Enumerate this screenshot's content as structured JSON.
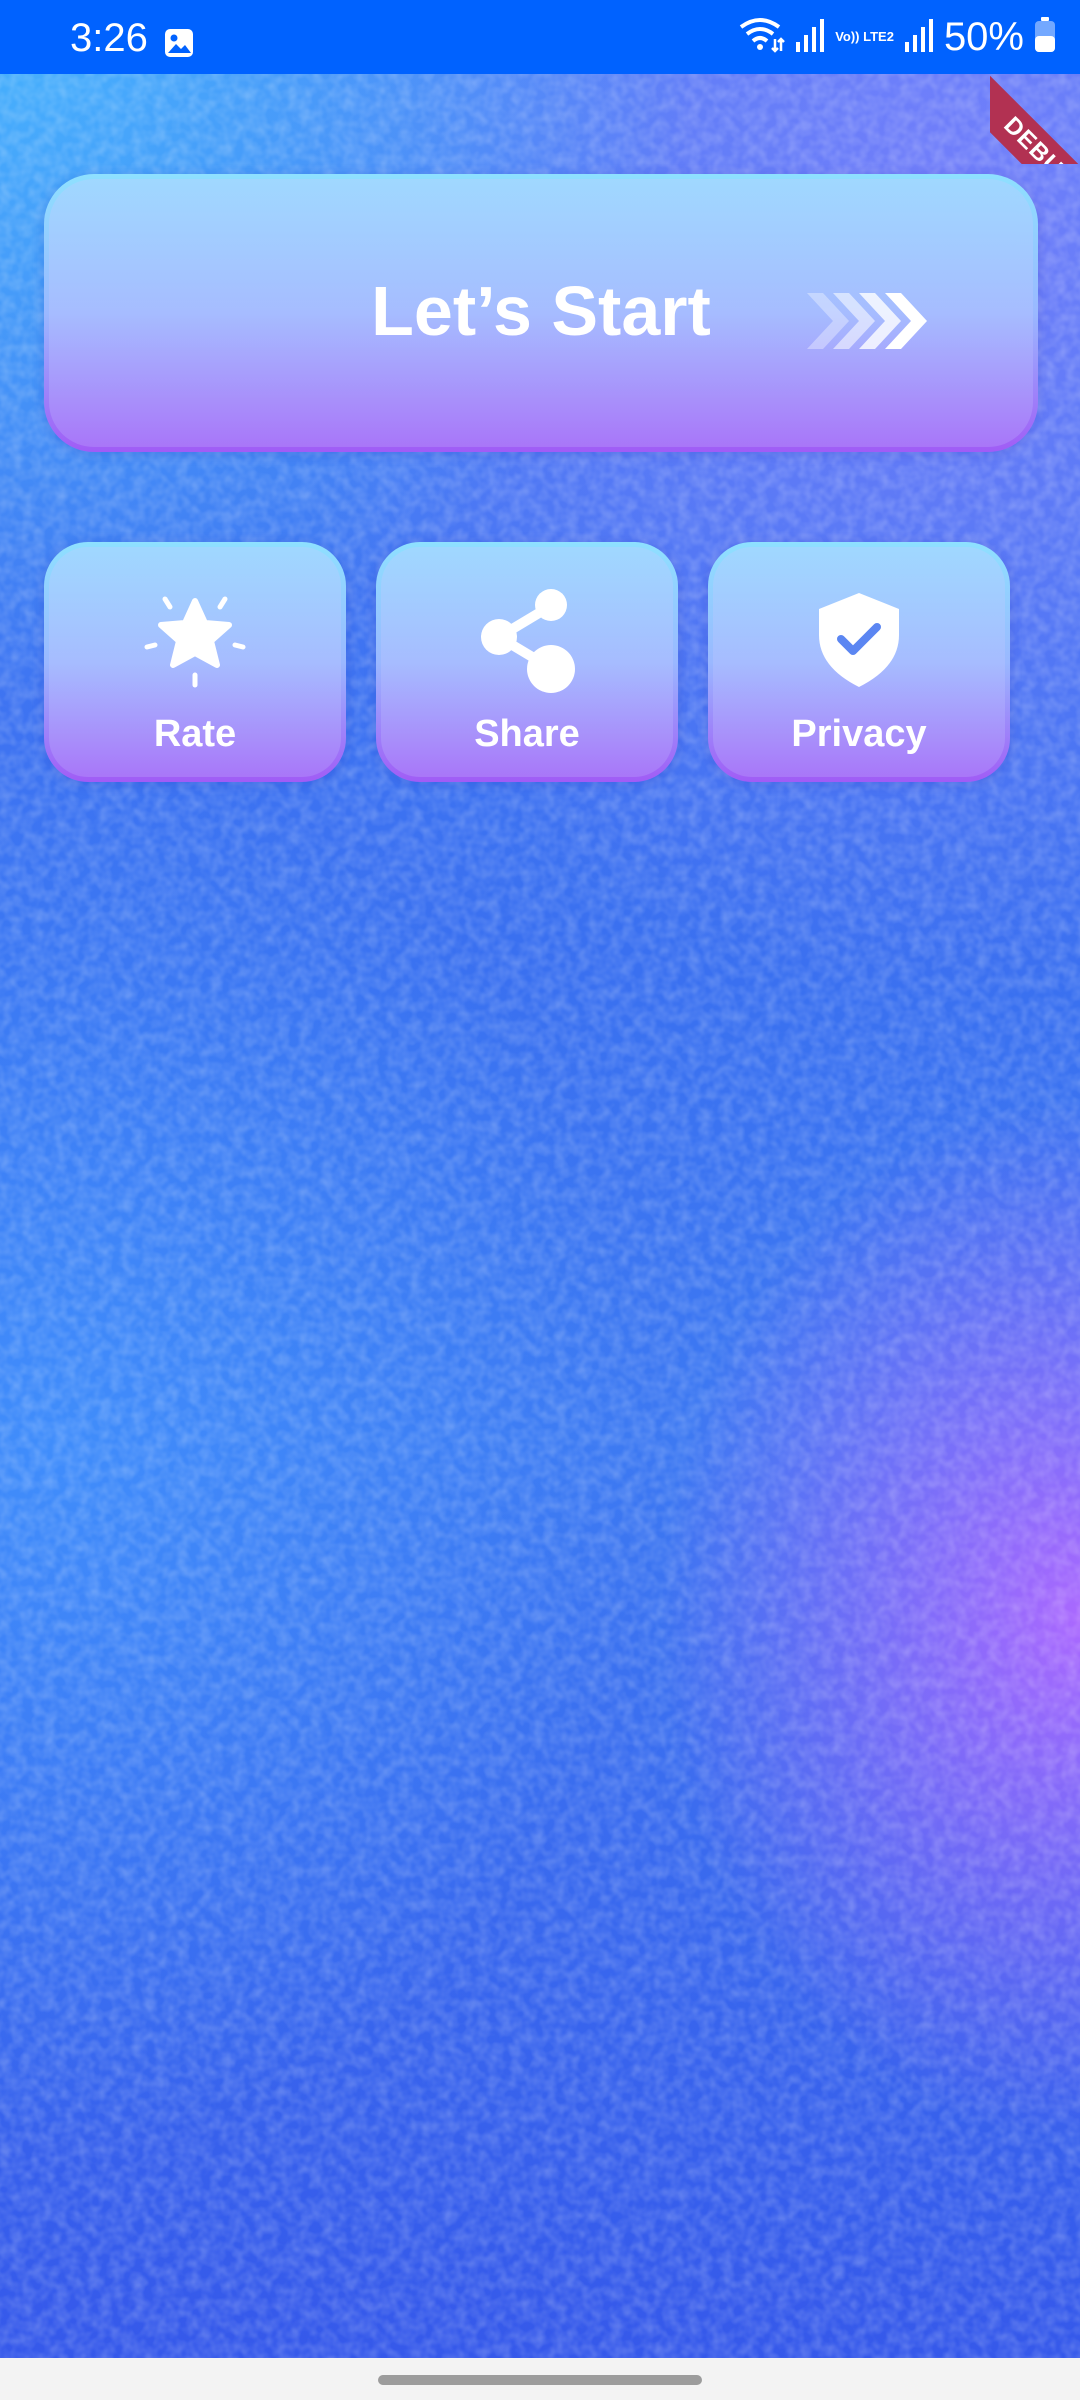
{
  "status_bar": {
    "time": "3:26",
    "network_label": "Vo)) LTE2",
    "battery_percent": "50%"
  },
  "debug_banner": {
    "text": "DEBUG"
  },
  "start_button": {
    "label": "Let’s Start"
  },
  "actions": [
    {
      "label": "Rate",
      "icon": "star-icon"
    },
    {
      "label": "Share",
      "icon": "share-icon"
    },
    {
      "label": "Privacy",
      "icon": "shield-check-icon"
    }
  ],
  "colors": {
    "status_bar": "#0062ff",
    "background_top": "#4a7df5",
    "background_accent": "#b068ff",
    "card_border_top": "#8ee0ff",
    "card_border_bottom": "#a05cf6",
    "debug_ribbon": "#b23152"
  }
}
